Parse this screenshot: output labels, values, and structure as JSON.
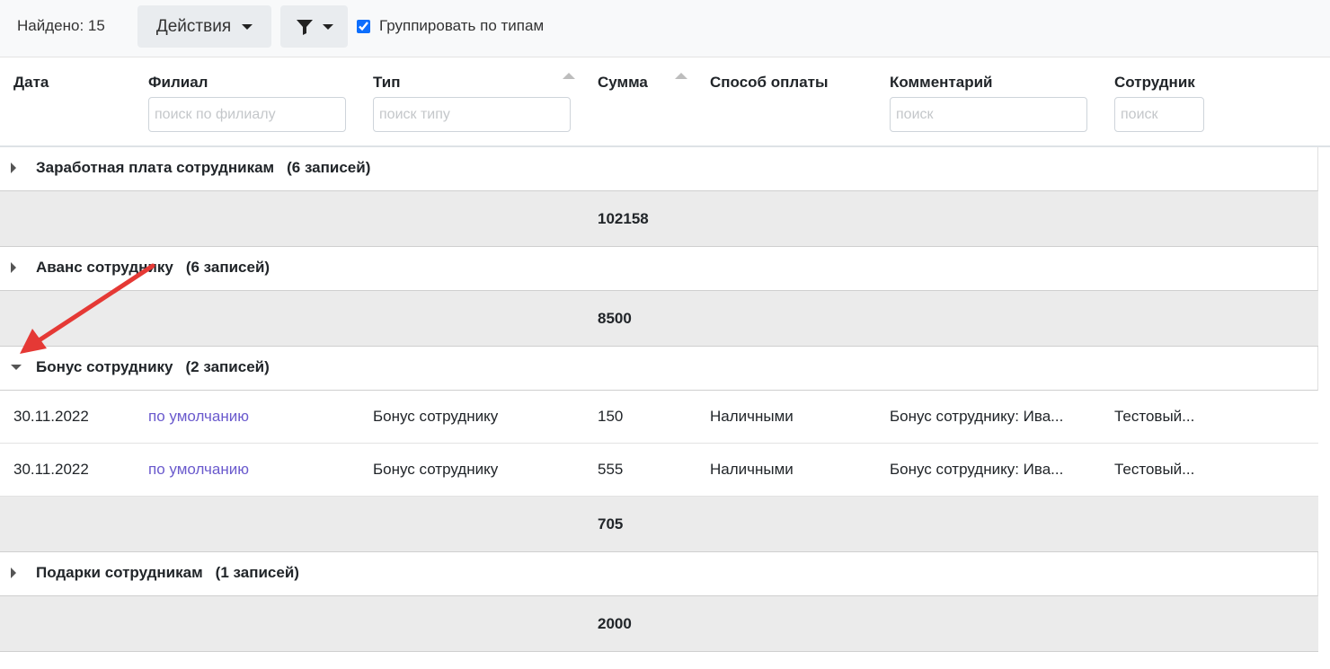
{
  "toolbar": {
    "found_label": "Найдено: 15",
    "actions_label": "Действия",
    "filter_icon": "funnel-icon",
    "group_by_type_label": "Группировать по типам",
    "group_by_type_checked": true
  },
  "columns": [
    {
      "label": "Дата"
    },
    {
      "label": "Филиал",
      "placeholder": "поиск по филиалу"
    },
    {
      "label": "Тип",
      "placeholder": "поиск типу"
    },
    {
      "label": "Сумма"
    },
    {
      "label": "Способ оплаты"
    },
    {
      "label": "Комментарий",
      "placeholder": "поиск"
    },
    {
      "label": "Сотрудник",
      "placeholder": "поиск"
    }
  ],
  "groups": [
    {
      "title": "Заработная плата сотрудникам",
      "count": "(6 записей)",
      "expanded": false,
      "total": "102158"
    },
    {
      "title": "Аванс сотруднику",
      "count": "(6 записей)",
      "expanded": false,
      "total": "8500"
    },
    {
      "title": "Бонус сотруднику",
      "count": "(2 записей)",
      "expanded": true,
      "total": "705",
      "rows": [
        {
          "date": "30.11.2022",
          "branch": "по умолчанию",
          "type": "Бонус сотруднику",
          "sum": "150",
          "payment": "Наличными",
          "comment": "Бонус сотруднику: Ива...",
          "employee": "Тестовый..."
        },
        {
          "date": "30.11.2022",
          "branch": "по умолчанию",
          "type": "Бонус сотруднику",
          "sum": "555",
          "payment": "Наличными",
          "comment": "Бонус сотруднику: Ива...",
          "employee": "Тестовый..."
        }
      ]
    },
    {
      "title": "Подарки сотрудникам",
      "count": "(1 записей)",
      "expanded": false,
      "total": "2000"
    }
  ],
  "colors": {
    "link": "#6a5acd",
    "annotation_arrow": "#e53935",
    "total_row_bg": "#ebebeb",
    "checkbox": "#0d6efd"
  }
}
